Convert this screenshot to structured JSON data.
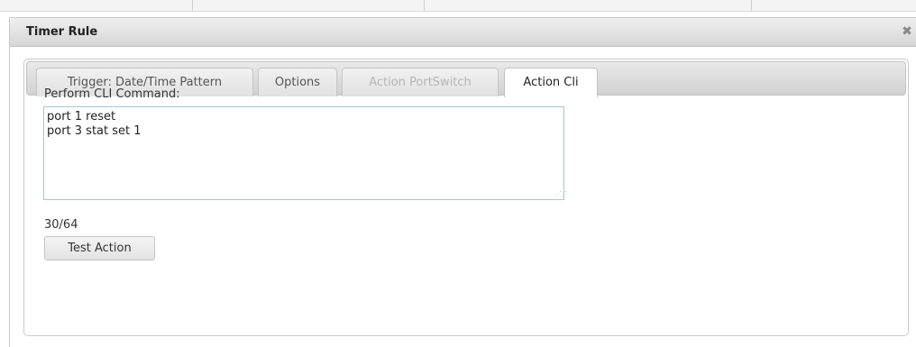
{
  "dialog": {
    "title": "Timer Rule",
    "close_icon": "close-icon",
    "close_glyph": "✖"
  },
  "tabs": [
    {
      "label": "Trigger: Date/Time Pattern",
      "state": "normal"
    },
    {
      "label": "Options",
      "state": "normal"
    },
    {
      "label": "Action PortSwitch",
      "state": "disabled"
    },
    {
      "label": "Action Cli",
      "state": "active"
    }
  ],
  "action_cli": {
    "label": "Perform CLI Command:",
    "command_value": "port 1 reset\nport 3 stat set 1",
    "char_counter": "30/64",
    "test_button_label": "Test Action"
  },
  "colors": {
    "textarea_border": "#a9c5d3",
    "disabled_tab_text": "#b5b5b5"
  }
}
